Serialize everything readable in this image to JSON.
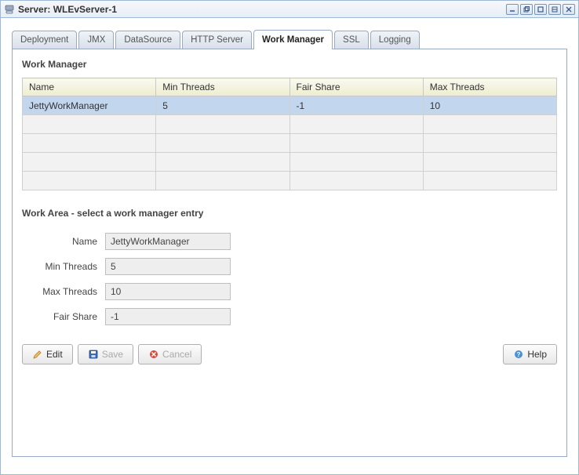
{
  "header": {
    "title": "Server: WLEvServer-1"
  },
  "tabs": [
    {
      "label": "Deployment"
    },
    {
      "label": "JMX"
    },
    {
      "label": "DataSource"
    },
    {
      "label": "HTTP Server"
    },
    {
      "label": "Work Manager",
      "active": true
    },
    {
      "label": "SSL"
    },
    {
      "label": "Logging"
    }
  ],
  "section": {
    "title": "Work Manager"
  },
  "table": {
    "columns": [
      "Name",
      "Min Threads",
      "Fair Share",
      "Max Threads"
    ],
    "rows": [
      {
        "name": "JettyWorkManager",
        "min": "5",
        "fair": "-1",
        "max": "10",
        "selected": true
      },
      {
        "name": "",
        "min": "",
        "fair": "",
        "max": ""
      },
      {
        "name": "",
        "min": "",
        "fair": "",
        "max": ""
      },
      {
        "name": "",
        "min": "",
        "fair": "",
        "max": ""
      },
      {
        "name": "",
        "min": "",
        "fair": "",
        "max": ""
      }
    ]
  },
  "workarea": {
    "header": "Work Area - select a work manager entry",
    "fields": {
      "name_label": "Name",
      "name_value": "JettyWorkManager",
      "min_label": "Min Threads",
      "min_value": "5",
      "max_label": "Max Threads",
      "max_value": "10",
      "fair_label": "Fair Share",
      "fair_value": "-1"
    }
  },
  "buttons": {
    "edit": "Edit",
    "save": "Save",
    "cancel": "Cancel",
    "help": "Help"
  }
}
